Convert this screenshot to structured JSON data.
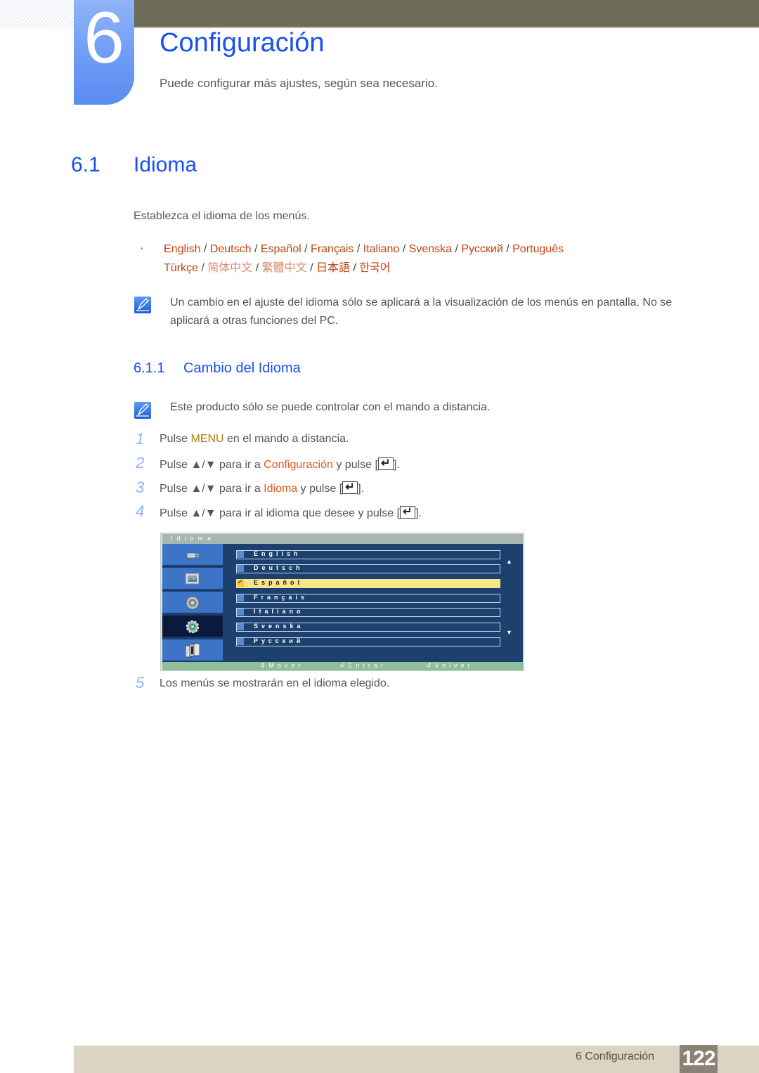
{
  "header": {
    "chapter_number": "6",
    "chapter_title": "Configuración",
    "chapter_subtitle": "Puede configurar más ajustes, según sea necesario."
  },
  "section": {
    "number": "6.1",
    "title": "Idioma",
    "description": "Establezca el idioma de los menús."
  },
  "languages": {
    "bullet": "•",
    "separator": "/",
    "line1": [
      "English",
      "Deutsch",
      "Español",
      "Français",
      "Italiano",
      "Svenska",
      "Русский",
      "Português"
    ],
    "line2": [
      "Türkçe",
      "简体中文",
      "繁體中文",
      "日本語",
      "한국어"
    ]
  },
  "notes": {
    "language_note": "Un cambio en el ajuste del idioma sólo se aplicará a la visualización de los menús en pantalla. No se aplicará a otras funciones del PC.",
    "remote_note": "Este producto sólo se puede controlar con el mando a distancia."
  },
  "subsection": {
    "number": "6.1.1",
    "title": "Cambio del Idioma"
  },
  "steps": [
    {
      "num": "1",
      "pre": "Pulse ",
      "highlight": "MENU",
      "post": " en el mando a distancia."
    },
    {
      "num": "2",
      "pre": "Pulse ▲/▼ para ir a ",
      "highlight": "Configuración",
      "post": " y pulse ["
    },
    {
      "num": "3",
      "pre": "Pulse ▲/▼ para ir a ",
      "highlight": "Idioma",
      "post": " y pulse ["
    },
    {
      "num": "4",
      "pre": "Pulse ▲/▼ para ir al idioma que desee y pulse [",
      "highlight": "",
      "post": ""
    },
    {
      "num": "5",
      "pre": "Los menús se mostrarán en el idioma elegido.",
      "highlight": "",
      "post": ""
    }
  ],
  "step_suffix": "].",
  "osd": {
    "title": "Idioma",
    "categories": [
      {
        "icon": "input-icon",
        "active": false
      },
      {
        "icon": "picture-icon",
        "active": false
      },
      {
        "icon": "sound-icon",
        "active": false
      },
      {
        "icon": "setup-gear-icon",
        "active": true
      },
      {
        "icon": "multi-window-icon",
        "active": false
      }
    ],
    "options": [
      "English",
      "Deutsch",
      "Español",
      "Français",
      "Italiano",
      "Svenska",
      "Русский"
    ],
    "selected": "Español",
    "hints": {
      "move": "Mover",
      "enter": "Entrar",
      "back": "Volver"
    }
  },
  "footer": {
    "chapter_label": "6 Configuración",
    "page_number": "122"
  },
  "colors": {
    "heading_blue": "#1a4ff0",
    "link_orange": "#c1440e",
    "top_bar": "#6c6b57",
    "footer_bar": "#dad5c2",
    "page_badge": "#8c8175"
  }
}
